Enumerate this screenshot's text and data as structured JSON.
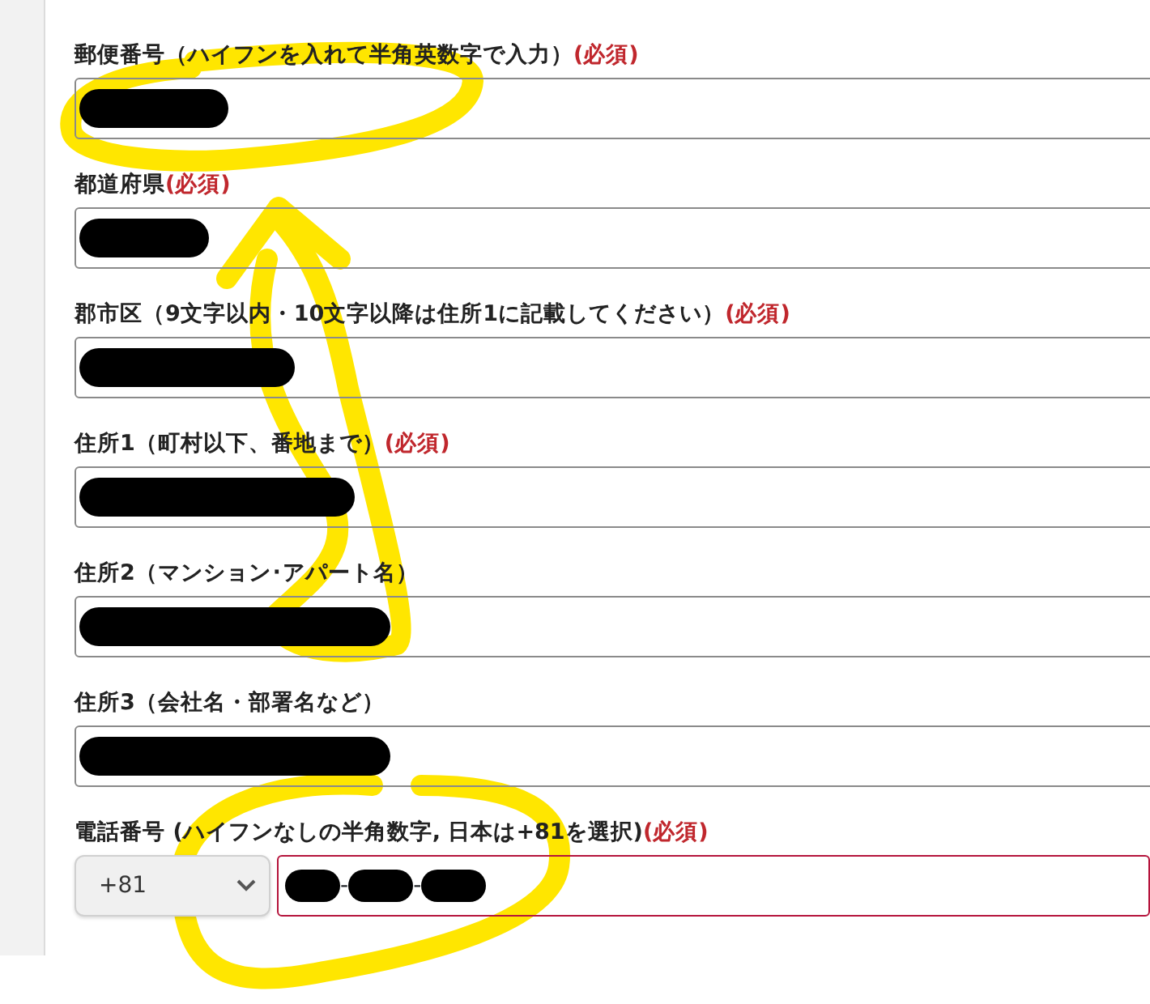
{
  "fields": [
    {
      "label": "郵便番号（ハイフンを入れて半角英数字で入力）",
      "required": true,
      "required_text": "(必須)",
      "redacted": true
    },
    {
      "label": "都道府県",
      "required": true,
      "required_text": "(必須)",
      "redacted": true
    },
    {
      "label": "郡市区（9文字以内・10文字以降は住所1に記載してください）",
      "required": true,
      "required_text": "(必須)",
      "redacted": true
    },
    {
      "label": "住所1（町村以下、番地まで）",
      "required": true,
      "required_text": "(必須)",
      "redacted": true
    },
    {
      "label": "住所2（マンション･アパート名）",
      "required": false,
      "redacted": true
    },
    {
      "label": "住所3（会社名・部署名など）",
      "required": false,
      "redacted": true
    }
  ],
  "phone": {
    "label": "電話番号 (ハイフンなしの半角数字, 日本は+81を選択)",
    "required": true,
    "required_text": "(必須)",
    "country_code": "+81",
    "invalid": true,
    "value_segments": [
      {
        "kind": "redacted"
      },
      {
        "kind": "text",
        "text": "-"
      },
      {
        "kind": "redacted"
      },
      {
        "kind": "text",
        "text": "-"
      },
      {
        "kind": "redacted"
      }
    ]
  }
}
